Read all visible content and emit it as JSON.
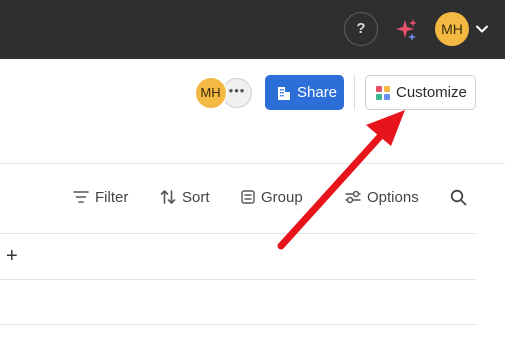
{
  "topbar": {
    "help_label": "?",
    "user_initials": "MH",
    "icons": {
      "help": "question-icon",
      "ai": "sparkle-icon",
      "menu": "chevron-down-icon"
    }
  },
  "header": {
    "collaborator_initials": "MH",
    "more_label": "•••",
    "share_label": "Share",
    "customize_label": "Customize"
  },
  "toolbar": {
    "filter_label": "Filter",
    "sort_label": "Sort",
    "group_label": "Group",
    "options_label": "Options"
  },
  "table": {
    "add_label": "+"
  },
  "colors": {
    "topbar_bg": "#2f2f2f",
    "avatar": "#f4b942",
    "share_button": "#2d6fd8",
    "annotation_arrow": "#e8141b"
  }
}
